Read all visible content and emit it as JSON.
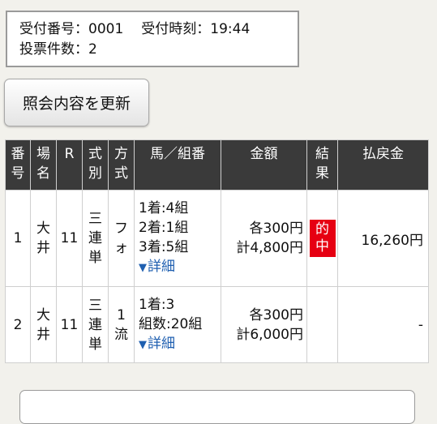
{
  "info": {
    "receipt_no_label": "受付番号：",
    "receipt_no": "0001",
    "receipt_time_label": "受付時刻：",
    "receipt_time": "19:44",
    "ticket_count_label": "投票件数：",
    "ticket_count": "2"
  },
  "refresh_button": {
    "label": "照会内容を更新"
  },
  "table": {
    "headers": [
      "番号",
      "場名",
      "R",
      "式別",
      "方式",
      "馬／組番",
      "金額",
      "結果",
      "払戻金"
    ],
    "rows": [
      {
        "no": "1",
        "venue": "大井",
        "race": "11",
        "bet_type": "三連単",
        "method": "フォ",
        "combo": [
          "1着:4組",
          "2着:1組",
          "3着:5組"
        ],
        "detail": "詳細",
        "amount_each": "各300円",
        "amount_total": "計4,800円",
        "result": "的中",
        "payout": "16,260円"
      },
      {
        "no": "2",
        "venue": "大井",
        "race": "11",
        "bet_type": "三連単",
        "method": "1流",
        "combo": [
          "1着:3",
          "組数:20組"
        ],
        "detail": "詳細",
        "amount_each": "各300円",
        "amount_total": "計6,000円",
        "result": "",
        "payout": "-"
      }
    ]
  },
  "colors": {
    "header_bg": "#3a3a3a",
    "hit_badge": "#e60012",
    "link": "#1f5fb0"
  },
  "icons": {
    "detail": "triangle-down-icon"
  }
}
